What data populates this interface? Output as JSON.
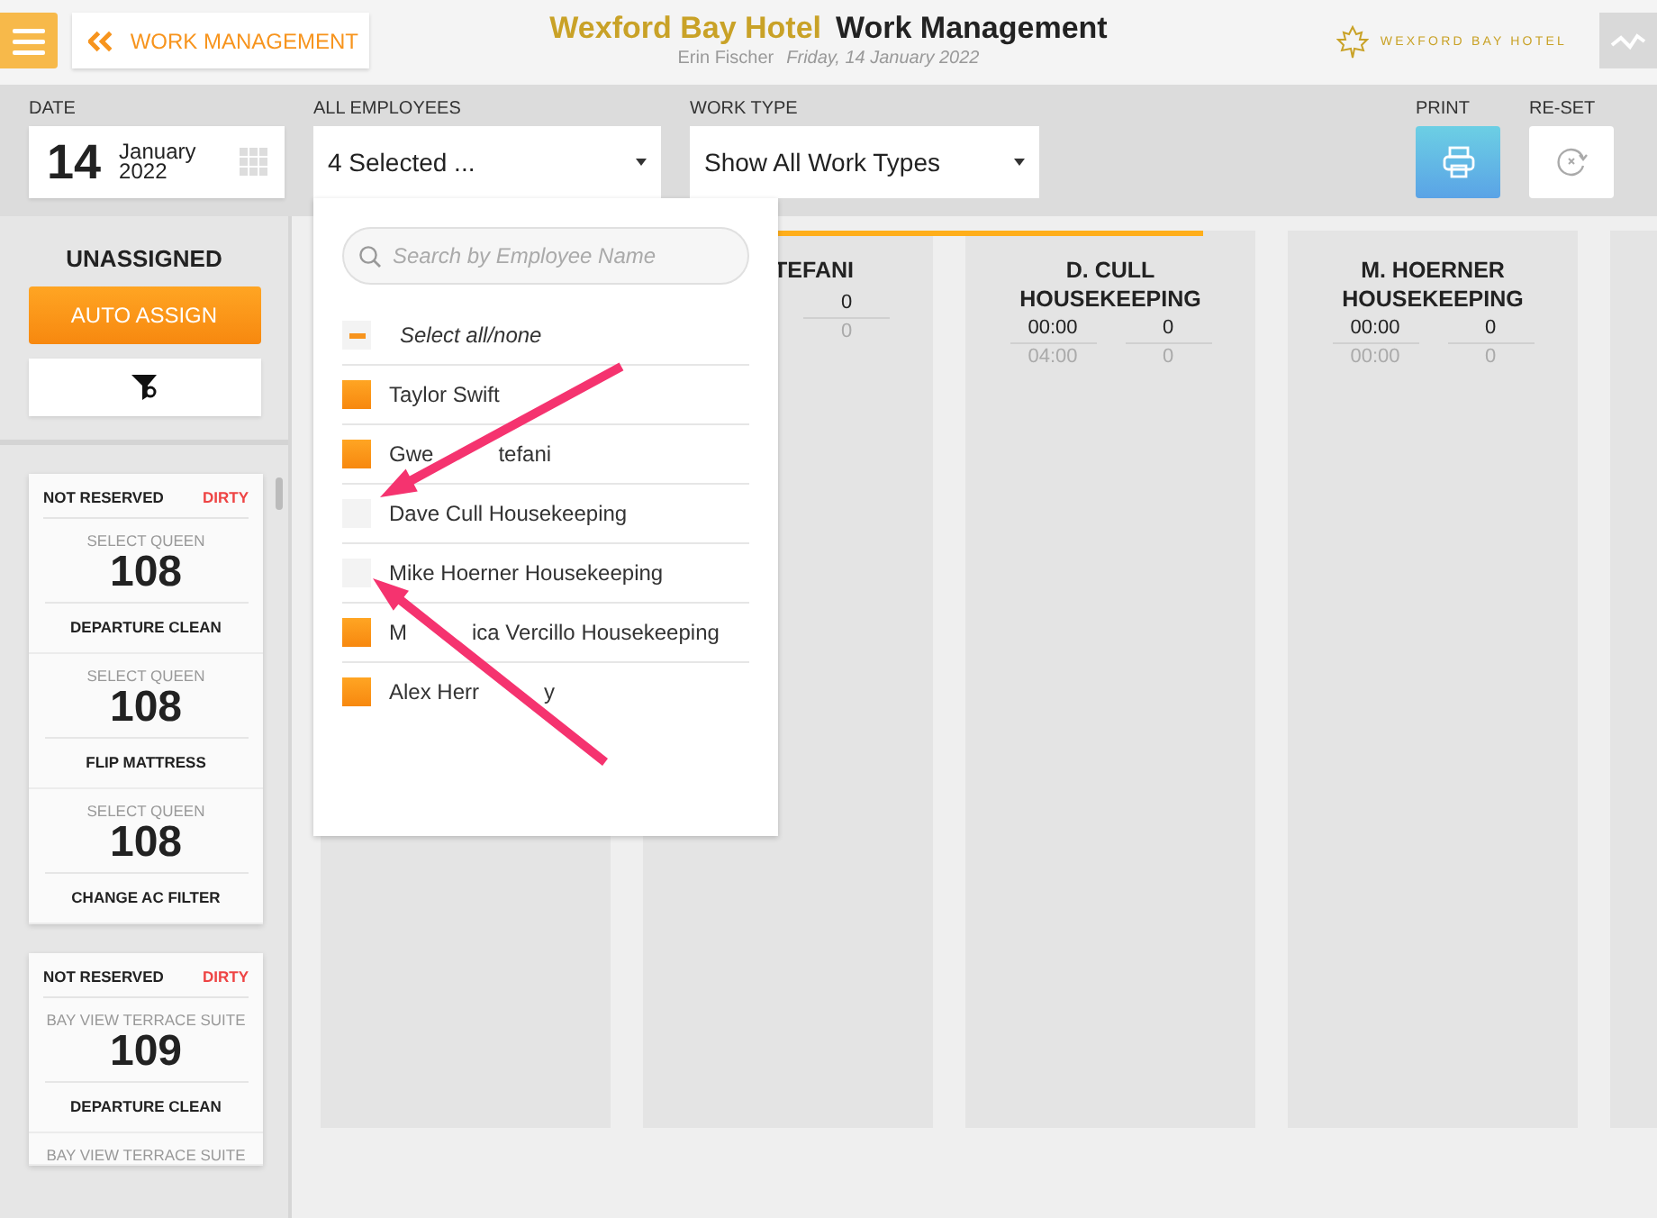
{
  "header": {
    "back_label": "WORK MANAGEMENT",
    "hotel": "Wexford Bay Hotel",
    "title": "Work Management",
    "user": "Erin Fischer",
    "date": "Friday, 14 January 2022",
    "logo_text": "WEXFORD BAY HOTEL"
  },
  "toolbar": {
    "date_label": "DATE",
    "day": "14",
    "month": "January",
    "year": "2022",
    "employees_label": "ALL EMPLOYEES",
    "employees_value": "4 Selected ...",
    "work_type_label": "WORK TYPE",
    "work_type_value": "Show All Work Types",
    "print_label": "PRINT",
    "reset_label": "RE-SET"
  },
  "sidebar": {
    "title": "UNASSIGNED",
    "auto_assign": "AUTO ASSIGN",
    "cards": [
      {
        "reservation": "NOT RESERVED",
        "status": "DIRTY",
        "items": [
          {
            "room_type": "SELECT QUEEN",
            "room": "108",
            "task": "DEPARTURE CLEAN"
          },
          {
            "room_type": "SELECT QUEEN",
            "room": "108",
            "task": "FLIP MATTRESS"
          },
          {
            "room_type": "SELECT QUEEN",
            "room": "108",
            "task": "CHANGE AC FILTER"
          }
        ]
      },
      {
        "reservation": "NOT RESERVED",
        "status": "DIRTY",
        "items": [
          {
            "room_type": "BAY VIEW TERRACE SUITE",
            "room": "109",
            "task": "DEPARTURE CLEAN"
          },
          {
            "room_type": "BAY VIEW TERRACE SUITE"
          }
        ]
      }
    ]
  },
  "columns": [
    {
      "name": "TEFANI",
      "count": "0",
      "count_planned": "0"
    },
    {
      "name": "D. CULL",
      "department": "HOUSEKEEPING",
      "time": "00:00",
      "time_planned": "04:00",
      "count": "0",
      "count_planned": "0"
    },
    {
      "name": "M. HOERNER",
      "department": "HOUSEKEEPING",
      "time": "00:00",
      "time_planned": "00:00",
      "count": "0",
      "count_planned": "0"
    }
  ],
  "employee_dropdown": {
    "search_placeholder": "Search by Employee Name",
    "select_all": {
      "label": "Select all/none",
      "indeterminate": true
    },
    "employees": [
      {
        "name": "Taylor Swift",
        "checked": true
      },
      {
        "name_parts": [
          "Gwe",
          "tefani"
        ],
        "checked": true
      },
      {
        "name": "Dave Cull Housekeeping",
        "checked": false
      },
      {
        "name": "Mike Hoerner Housekeeping",
        "checked": false
      },
      {
        "name_parts": [
          "M",
          "ica Vercillo Housekeeping"
        ],
        "checked": true
      },
      {
        "name_parts": [
          "Alex Herr",
          "y"
        ],
        "checked": true
      }
    ]
  }
}
